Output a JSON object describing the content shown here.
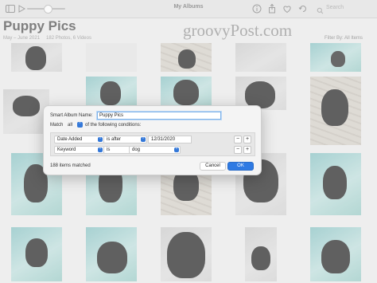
{
  "window": {
    "title": "My Albums",
    "search_placeholder": "Search"
  },
  "album": {
    "title": "Puppy Pics",
    "date_range": "May – June 2021",
    "counts": "182 Photos, 6 Videos",
    "filter_label": "Filter By: All Items"
  },
  "watermark": "groovyPost.com",
  "dialog": {
    "name_label": "Smart Album Name:",
    "name_value": "Puppy Pics",
    "match_label": "Match",
    "match_value": "all",
    "match_suffix": "of the following conditions:",
    "rules": [
      {
        "field": "Date Added",
        "operator": "is after",
        "value": "12/31/2020"
      },
      {
        "field": "Keyword",
        "operator": "is",
        "value": "dog"
      }
    ],
    "items_matched": "188 items matched",
    "cancel_label": "Cancel",
    "ok_label": "OK"
  },
  "icons": {
    "sidebar": "sidebar-icon",
    "slideshow": "slideshow-icon",
    "info": "info-icon",
    "share": "share-icon",
    "favorite": "heart-icon",
    "rotate": "rotate-icon",
    "search": "search-icon"
  },
  "colors": {
    "accent": "#2f7ae3",
    "grass": "#8fc7c8",
    "dog": "#303030"
  }
}
